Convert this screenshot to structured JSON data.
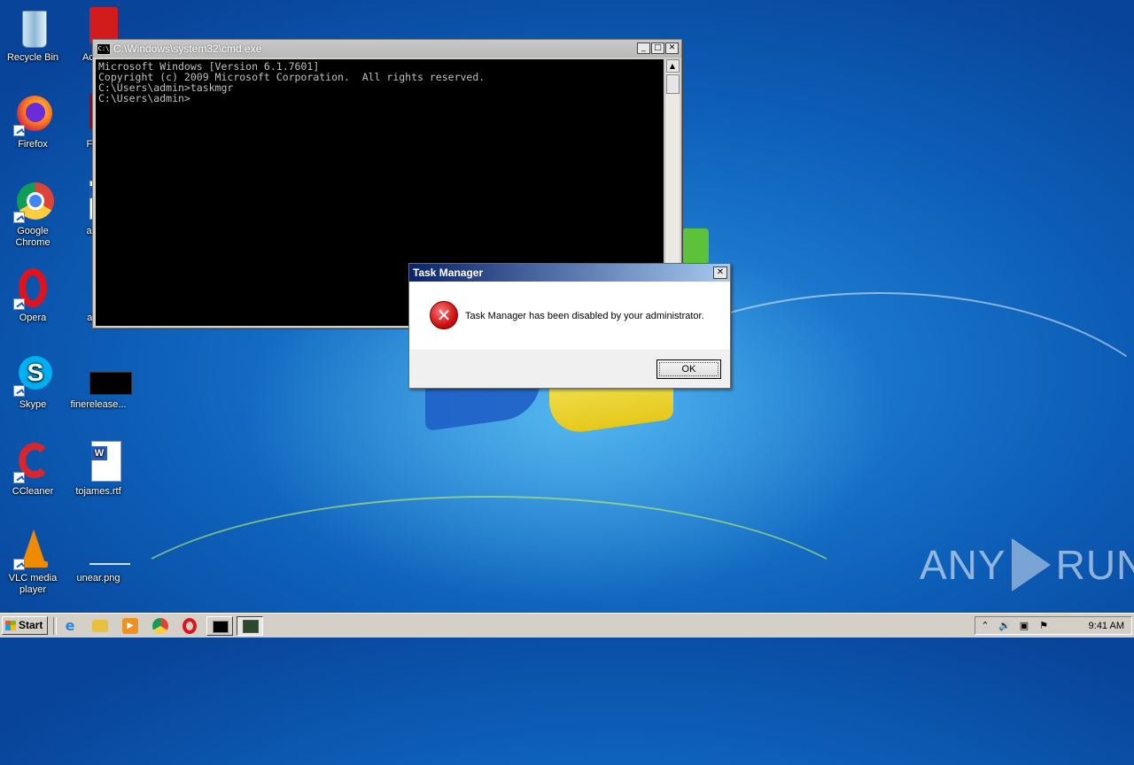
{
  "desktop": {
    "icons": [
      {
        "label": "Recycle Bin"
      },
      {
        "label": "Firefox"
      },
      {
        "label": "Google Chrome"
      },
      {
        "label": "Opera"
      },
      {
        "label": "Skype"
      },
      {
        "label": "CCleaner"
      },
      {
        "label": "VLC media player"
      },
      {
        "label": "Ac Rea"
      },
      {
        "label": "FileZi"
      },
      {
        "label": "ansta"
      },
      {
        "label": "away"
      },
      {
        "label": "finerelease..."
      },
      {
        "label": "tojames.rtf"
      },
      {
        "label": "unear.png"
      }
    ]
  },
  "cmd_window": {
    "title": "C:\\Windows\\system32\\cmd.exe",
    "icon_text": "C:\\",
    "lines": [
      "Microsoft Windows [Version 6.1.7601]",
      "Copyright (c) 2009 Microsoft Corporation.  All rights reserved.",
      "",
      "C:\\Users\\admin>taskmgr",
      "",
      "C:\\Users\\admin>"
    ]
  },
  "dialog": {
    "title": "Task Manager",
    "message": "Task Manager has been disabled by your administrator.",
    "ok_label": "OK",
    "close_glyph": "✕"
  },
  "taskbar": {
    "start_label": "Start",
    "clock": "9:41 AM"
  },
  "watermark": {
    "left": "ANY",
    "right": "RUN"
  },
  "colors": {
    "desktop_bg": "#0d5fb8",
    "dialog_title": "#0a246a",
    "error_red": "#d01010"
  }
}
